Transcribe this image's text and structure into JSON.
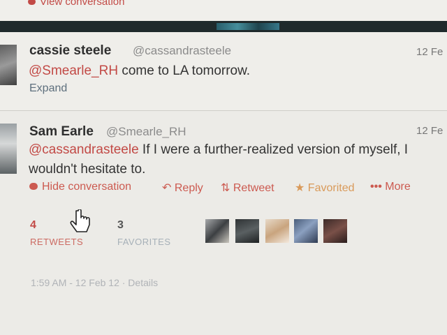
{
  "top": {
    "view_conversation": "View conversation"
  },
  "tweet1": {
    "name": "cassie steele",
    "handle": "@cassandrasteele",
    "date": "12 Fe",
    "mention": "@Smearle_RH",
    "text": " come to LA tomorrow.",
    "expand": "Expand"
  },
  "tweet2": {
    "name": "Sam Earle",
    "handle": "@Smearle_RH",
    "date": "12 Fe",
    "mention": "@cassandrasteele",
    "text_line1": " If I were a further-realized version of myself, I",
    "text_line2": "wouldn't hesitate to.",
    "actions": {
      "hide": "Hide conversation",
      "reply": "Reply",
      "retweet": "Retweet",
      "favorited": "Favorited",
      "more": "More"
    },
    "stats": {
      "retweets_count": "4",
      "retweets_label": "RETWEETS",
      "favorites_count": "3",
      "favorites_label": "FAVORITES"
    },
    "meta": "1:59 AM - 12 Feb 12 · Details"
  },
  "colors": {
    "accent_red": "#c24a46",
    "favorite_orange": "#d99a5a",
    "text": "#333333",
    "muted": "#8b8b8b"
  },
  "icons": [
    "chat-bubble-icon",
    "reply-arrow-icon",
    "retweet-icon",
    "star-icon",
    "more-dots-icon",
    "hand-cursor-icon"
  ]
}
